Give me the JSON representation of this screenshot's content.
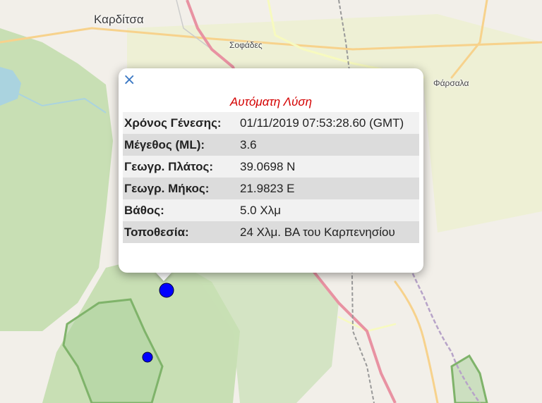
{
  "map": {
    "places": [
      {
        "id": "karditsa",
        "label": "Καρδίτσα"
      },
      {
        "id": "sofades",
        "label": "Σοφάδες"
      },
      {
        "id": "farsala",
        "label": "Φάρσαλα"
      }
    ],
    "markers": [
      {
        "id": "main-event",
        "color": "#0000ff"
      },
      {
        "id": "secondary-event",
        "color": "#0000ff"
      }
    ],
    "colors": {
      "land": "#f2efe9",
      "forest": "#add19e",
      "water": "#aad3df",
      "highway": "#e892a2",
      "road": "#f7fabf",
      "boundary": "#9c7fb3"
    }
  },
  "popup": {
    "close_label": "×",
    "title": "Αυτόματη Λύση",
    "rows": [
      {
        "label": "Χρόνος Γένεσης:",
        "value": "01/11/2019 07:53:28.60 (GMT)"
      },
      {
        "label": "Μέγεθος (ML):",
        "value": "3.6"
      },
      {
        "label": "Γεωγρ. Πλάτος:",
        "value": "39.0698 N"
      },
      {
        "label": "Γεωγρ. Μήκος:",
        "value": "21.9823 E"
      },
      {
        "label": "Βάθος:",
        "value": "5.0 Χλμ"
      },
      {
        "label": "Τοποθεσία:",
        "value": "24 Χλμ. ΒΑ του Καρπενησίου"
      }
    ]
  }
}
